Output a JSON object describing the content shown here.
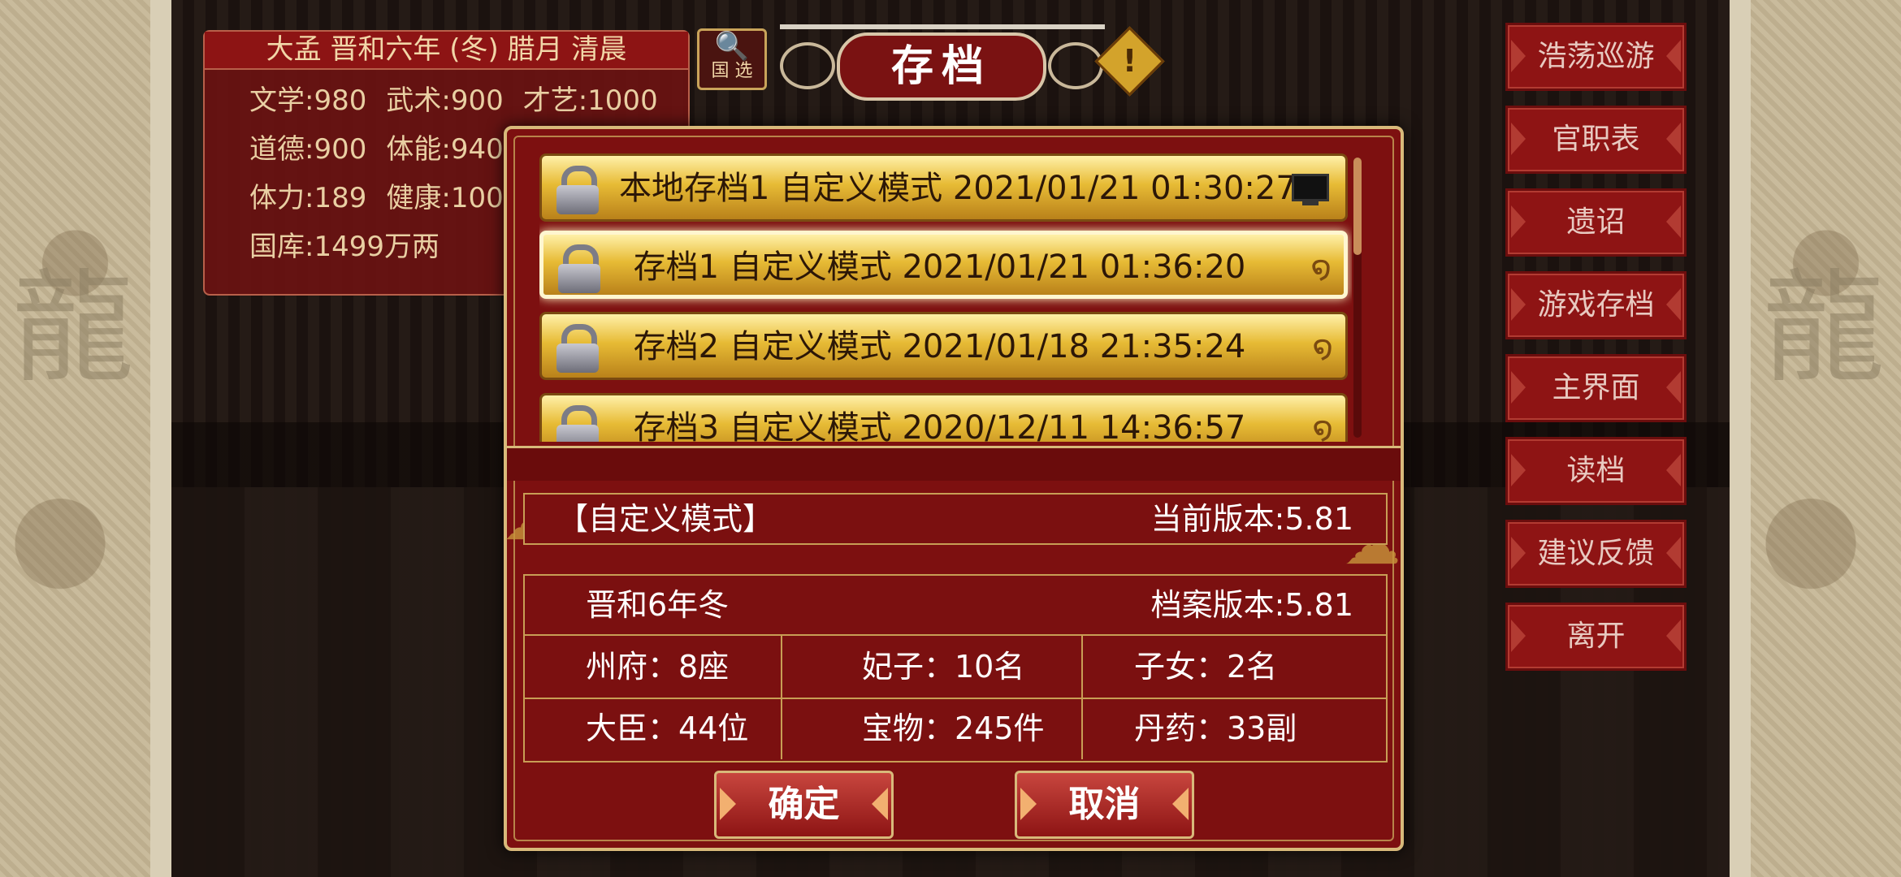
{
  "status_panel": {
    "title": "大孟 晋和六年 (冬) 腊月 清晨",
    "row1": [
      "文学:980",
      "武术:900",
      "才艺:1000"
    ],
    "row2": [
      "道德:900",
      "体能:940"
    ],
    "row3": [
      "体力:189",
      "健康:100"
    ],
    "row4": [
      "国库:1499万两"
    ]
  },
  "search_button": {
    "label": "国\n选"
  },
  "dialog_title": "存档",
  "warning_icon": "!",
  "right_menu": [
    "浩荡巡游",
    "官职表",
    "遗诏",
    "游戏存档",
    "主界面",
    "读档",
    "建议反馈",
    "离开"
  ],
  "save_slots": [
    {
      "label": "本地存档1  自定义模式  2021/01/21 01:30:27",
      "icon": "computer-icon"
    },
    {
      "label": "存档1  自定义模式  2021/01/21 01:36:20",
      "icon": "swirl-icon"
    },
    {
      "label": "存档2  自定义模式  2021/01/18 21:35:24",
      "icon": "swirl-icon"
    },
    {
      "label": "存档3  自定义模式  2020/12/11 14:36:57",
      "icon": "swirl-icon"
    }
  ],
  "detail": {
    "mode": "【自定义模式】",
    "current_version": "当前版本:5.81",
    "date": "晋和6年冬",
    "archive_version": "档案版本:5.81",
    "stats": [
      [
        "州府：8座",
        "妃子：10名",
        "子女：2名"
      ],
      [
        "大臣：44位",
        "宝物：245件",
        "丹药：33副"
      ]
    ]
  },
  "buttons": {
    "confirm": "确定",
    "cancel": "取消"
  }
}
